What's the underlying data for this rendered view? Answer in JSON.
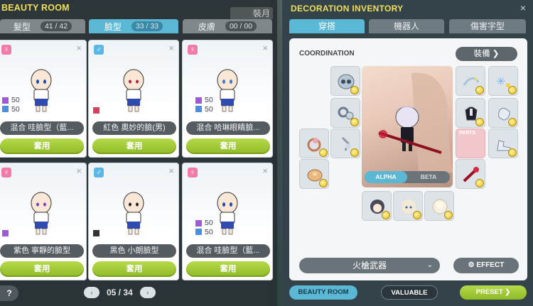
{
  "left": {
    "title": "BEAUTY ROOM",
    "ghost_label": "裝月",
    "tabs": [
      {
        "label": "髮型",
        "count": "41 / 42",
        "active": false
      },
      {
        "label": "臉型",
        "count": "33 / 33",
        "active": true
      },
      {
        "label": "皮膚",
        "count": "00 / 00",
        "active": false
      }
    ],
    "cards": [
      {
        "gender": "♀",
        "name": "混合 哇臉型（藍...",
        "v1": "50",
        "v2": "50",
        "apply": "套用"
      },
      {
        "gender": "♂",
        "name": "紅色 奧妙的臉(男)",
        "apply": "套用"
      },
      {
        "gender": "♀",
        "name": "混合 哈琳眼睛臉...",
        "v1": "50",
        "v2": "50",
        "apply": "套用"
      },
      {
        "gender": "♀",
        "name": "紫色 寧靜的臉型",
        "apply": "套用"
      },
      {
        "gender": "♂",
        "name": "黑色 小朗臉型",
        "apply": "套用"
      },
      {
        "gender": "♀",
        "name": "混合 哇臉型（藍...",
        "v1": "50",
        "v2": "50",
        "apply": "套用"
      }
    ],
    "help": "?",
    "page": "05 / 34",
    "prev": "‹",
    "next": "›"
  },
  "right": {
    "title": "DECORATION  INVENTORY",
    "close": "×",
    "tabs": [
      {
        "label": "穿搭",
        "active": true
      },
      {
        "label": "機器人",
        "active": false
      },
      {
        "label": "傷害字型",
        "active": false
      }
    ],
    "coord_label": "COORDINATION",
    "equip_label": "裝備  ❯",
    "slot_parts": "PARTS",
    "toggle": {
      "alpha": "ALPHA",
      "beta": "BETA"
    },
    "weapon_dropdown": "火槍武器",
    "effect": "⚙ EFFECT",
    "beauty_room": "BEAUTY ROOM",
    "valuable": "VALUABLE",
    "preset": "PRESET  ❯"
  },
  "colors": {
    "accent": "#5bb8d4",
    "apply_green": "#9cc630",
    "title_yellow": "#f1df5a",
    "purple": "#a05ad8",
    "blue": "#4a8fe0",
    "red": "#d84060",
    "black": "#333333"
  }
}
